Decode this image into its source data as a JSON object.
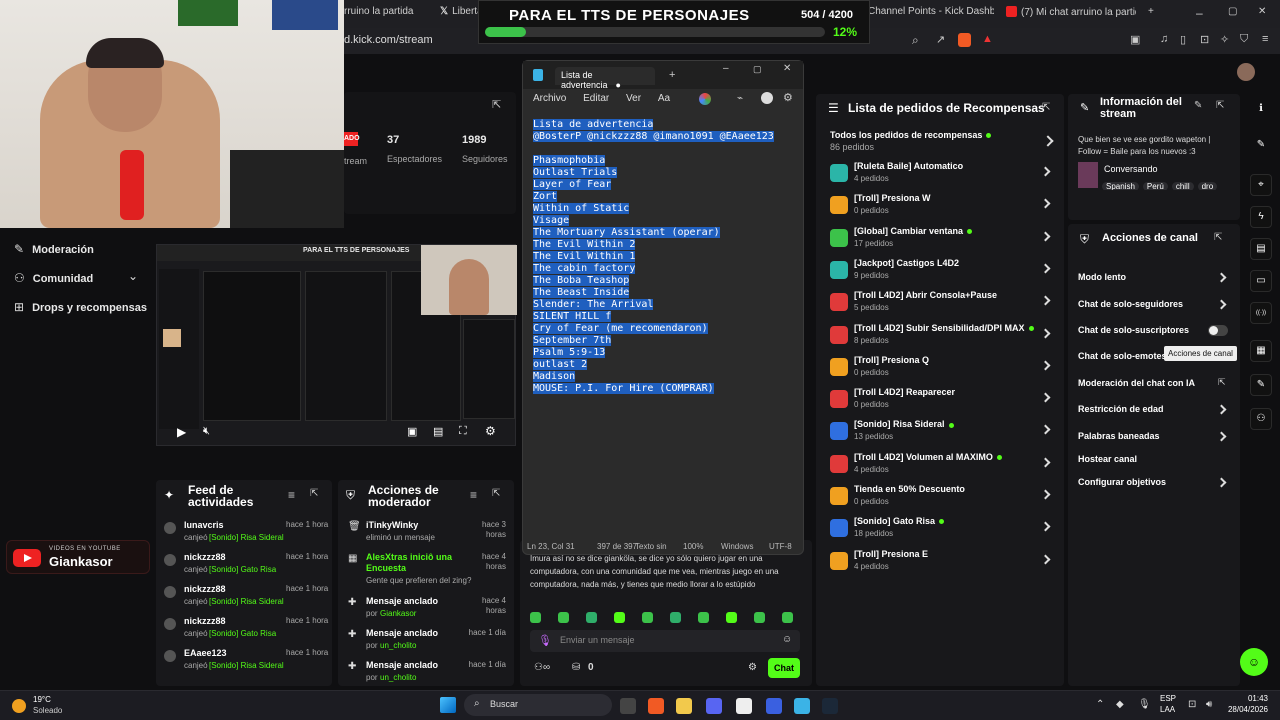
{
  "browser": {
    "tabs": [
      {
        "label": "rruino la partida"
      },
      {
        "label": "Libertad"
      },
      {
        "label": "Channel Points - Kick Dashboard"
      },
      {
        "label": "(7) Mi chat arruino la partida"
      }
    ],
    "url": "d.kick.com/stream"
  },
  "goal_overlay": {
    "title": "PARA EL TTS DE PERSONAJES",
    "count": "504 / 4200",
    "percent": "12%",
    "progress": 0.12
  },
  "left_nav": {
    "items": [
      {
        "label": "Moderación"
      },
      {
        "label": "Comunidad"
      },
      {
        "label": "Drops y recompensas"
      }
    ]
  },
  "stats": {
    "live_badge": "ADO",
    "stream_label": "tream",
    "viewers_value": "37",
    "viewers_label": "Espectadores",
    "followers_value": "1989",
    "followers_label": "Seguidores"
  },
  "preview": {
    "inner_title": "PARA EL TTS DE PERSONAJES"
  },
  "youtube_badge": {
    "top": "VIDEOS EN YOUTUBE",
    "name": "Giankasor"
  },
  "activity_feed": {
    "title_line1": "Feed de",
    "title_line2": "actividades",
    "items": [
      {
        "user": "lunavcris",
        "time": "hace 1 hora",
        "action": "canjeó",
        "reward": "[Sonido] Risa Sideral"
      },
      {
        "user": "nickzzz88",
        "time": "hace 1 hora",
        "action": "canjeó",
        "reward": "[Sonido] Gato Risa"
      },
      {
        "user": "nickzzz88",
        "time": "hace 1 hora",
        "action": "canjeó",
        "reward": "[Sonido] Risa Sideral"
      },
      {
        "user": "nickzzz88",
        "time": "hace 1 hora",
        "action": "canjeó",
        "reward": "[Sonido] Gato Risa"
      },
      {
        "user": "EAaee123",
        "time": "hace 1 hora",
        "action": "canjeó",
        "reward": "[Sonido] Risa Sideral"
      }
    ]
  },
  "mod_actions": {
    "title_line1": "Acciones de",
    "title_line2": "moderador",
    "items": [
      {
        "title": "iTinkyWinky",
        "time": "hace 3 horas",
        "sub": "eliminó un mensaje"
      },
      {
        "title": "AlesXtras iniciô una Encuesta",
        "time": "hace 4 horas",
        "sub": "Gente que prefieren del zing?"
      },
      {
        "title": "Mensaje anclado",
        "time": "hace 4 horas",
        "sub_prefix": "por",
        "sub": "Giankasor"
      },
      {
        "title": "Mensaje anclado",
        "time": "hace 1 día",
        "sub_prefix": "por",
        "sub": "un_cholito"
      },
      {
        "title": "Mensaje anclado",
        "time": "hace 1 día",
        "sub_prefix": "por",
        "sub": "un_cholito"
      }
    ]
  },
  "notepad": {
    "tab_title": "Lista de advertencia",
    "menu": [
      "Archivo",
      "Editar",
      "Ver"
    ],
    "lines": [
      "Lista de advertencia",
      "@BosterP @nickzzz88 @imano1091 @EAaee123",
      "",
      "Phasmophobia",
      "Outlast Trials",
      "Layer of Fear",
      "Zort",
      "Within of Static",
      "Visage",
      "The Mortuary Assistant (operar)",
      "The Evil Within 2",
      "The Evil Within 1",
      "The cabin factory",
      "The Boba Teashop",
      "The Beast Inside",
      "Slender: The Arrival",
      "SILENT HILL f",
      "Cry of Fear (me recomendaron)",
      "September 7th",
      "Psalm 5:9-13",
      "outlast 2",
      "Madison",
      "MOUSE: P.I. For Hire (COMPRAR)"
    ],
    "status": {
      "position": "Ln 23, Col 31",
      "chars": "397 de 397",
      "format": "Texto sin",
      "zoom": "100%",
      "eol": "Windows",
      "encoding": "UTF-8"
    }
  },
  "chat": {
    "message": "Imura así no se dice gianköla, se dice yo sólo quiero jugar en una computadora, con una comunidad que me vea, mientras juego en una computadora, nada más, y tienes que medio llorar a lo estúpido",
    "placeholder": "Enviar un mensaje",
    "points": "0",
    "send_label": "Chat"
  },
  "rewards": {
    "title": "Lista de pedidos de Recompensas",
    "all_label": "Todos los pedidos de recompensas",
    "all_count": "86 pedidos",
    "items": [
      {
        "name": "[Ruleta Baile] Automatico",
        "count": "4 pedidos",
        "color": "#2bb5a8",
        "active": false
      },
      {
        "name": "[Troll] Presiona W",
        "count": "0 pedidos",
        "color": "#f0a020",
        "active": false
      },
      {
        "name": "[Global] Cambiar ventana",
        "count": "17 pedidos",
        "color": "#3cc24a",
        "active": true
      },
      {
        "name": "[Jackpot] Castigos L4D2",
        "count": "9 pedidos",
        "color": "#2bb5a8",
        "active": false
      },
      {
        "name": "[Troll L4D2] Abrir Consola+Pause",
        "count": "5 pedidos",
        "color": "#e03a3a",
        "active": false
      },
      {
        "name": "[Troll L4D2] Subir Sensibilidad/DPI MAX",
        "count": "8 pedidos",
        "color": "#e03a3a",
        "active": true
      },
      {
        "name": "[Troll] Presiona Q",
        "count": "0 pedidos",
        "color": "#f0a020",
        "active": false
      },
      {
        "name": "[Troll L4D2] Reaparecer",
        "count": "0 pedidos",
        "color": "#e03a3a",
        "active": false
      },
      {
        "name": "[Sonido] Risa Sideral",
        "count": "13 pedidos",
        "color": "#2f6fe0",
        "active": true
      },
      {
        "name": "[Troll L4D2] Volumen al MAXIMO",
        "count": "4 pedidos",
        "color": "#e03a3a",
        "active": true
      },
      {
        "name": "Tienda en 50% Descuento",
        "count": "0 pedidos",
        "color": "#f0a020",
        "active": false
      },
      {
        "name": "[Sonido] Gato Risa",
        "count": "18 pedidos",
        "color": "#2f6fe0",
        "active": true
      },
      {
        "name": "[Troll] Presiona E",
        "count": "4 pedidos",
        "color": "#f0a020",
        "active": false
      }
    ]
  },
  "stream_info": {
    "title": "Información del stream",
    "desc": "Que bien se ve ese gordito wapeton | Follow = Baile para los nuevos :3",
    "category": "Conversando",
    "tags": [
      "Spanish",
      "Perú",
      "chill",
      "dro"
    ]
  },
  "channel_actions": {
    "title": "Acciones de canal",
    "items": [
      {
        "label": "Modo lento",
        "kind": "chevron"
      },
      {
        "label": "Chat de solo-seguidores",
        "kind": "chevron"
      },
      {
        "label": "Chat de solo-suscriptores",
        "kind": "toggle"
      },
      {
        "label": "Chat de solo-emotes",
        "kind": "none"
      },
      {
        "label": "Moderación del chat con IA",
        "kind": "external"
      },
      {
        "label": "Restricción de edad",
        "kind": "chevron"
      },
      {
        "label": "Palabras baneadas",
        "kind": "chevron"
      },
      {
        "label": "Hostear canal",
        "kind": "none"
      },
      {
        "label": "Configurar objetivos",
        "kind": "chevron"
      }
    ],
    "tooltip": "Acciones de canal"
  },
  "taskbar": {
    "weather_temp": "19°C",
    "weather_desc": "Soleado",
    "search": "Buscar",
    "lang": "ESP",
    "lang2": "LAA",
    "time": "01:43",
    "date": "28/04/2026"
  },
  "colors": {
    "accent": "#53fc18",
    "selection": "#1f5fbf"
  }
}
